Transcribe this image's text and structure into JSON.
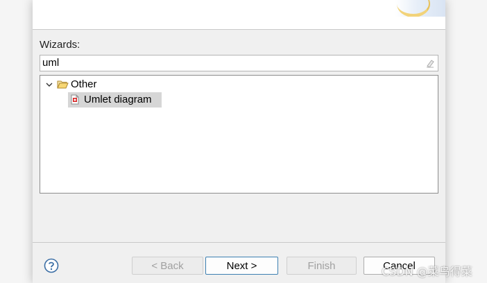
{
  "wizard_page": {
    "wizards_label": "Wizards:",
    "filter": {
      "value": "uml",
      "placeholder": ""
    }
  },
  "tree": {
    "items": [
      {
        "label": "Other",
        "icon": "folder-open-icon",
        "expanded": true
      },
      {
        "label": "Umlet diagram",
        "icon": "file-icon",
        "selected": true
      }
    ]
  },
  "buttons": {
    "help": "help-icon",
    "back": "< Back",
    "next": "Next >",
    "finish": "Finish",
    "cancel": "Cancel"
  },
  "watermark": "CSDN @菜鸟得菜",
  "colors": {
    "dialog_bg": "#f0f0f0",
    "selection_bg": "#d6d6d6",
    "default_button_border": "#3c7fb1",
    "help_icon": "#3b6ea5"
  }
}
